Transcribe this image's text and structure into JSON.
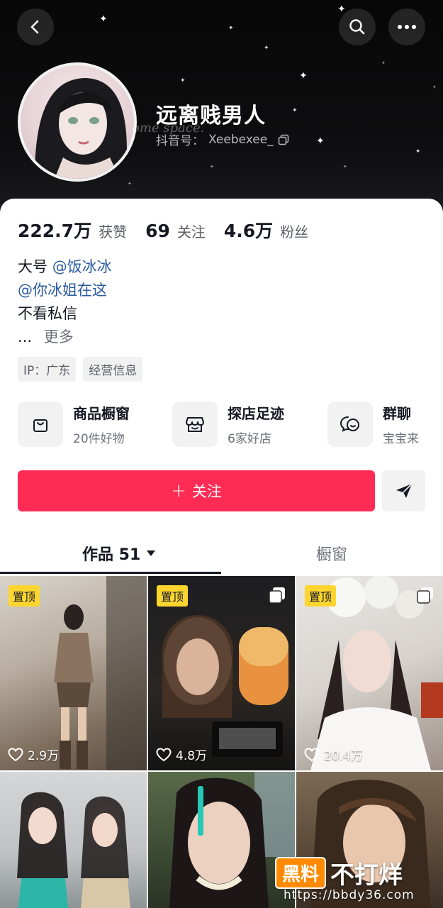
{
  "header": {
    "bg_text": "ome space.",
    "nickname": "远离贱男人",
    "douyin_id_label": "抖音号：",
    "douyin_id": "Xeebexee_"
  },
  "stats": [
    {
      "num": "222.7万",
      "label": "获赞"
    },
    {
      "num": "69",
      "label": "关注"
    },
    {
      "num": "4.6万",
      "label": "粉丝"
    }
  ],
  "bio": {
    "line1_prefix": "大号",
    "line1_mention": "@饭冰冰",
    "line2_mention": "@你冰姐在这",
    "line3": "不看私信",
    "ellipsis": "...",
    "more": "更多"
  },
  "tags": [
    "IP：广东",
    "经营信息"
  ],
  "services": [
    {
      "title": "商品橱窗",
      "sub": "20件好物",
      "icon": "shopping-bag-icon"
    },
    {
      "title": "探店足迹",
      "sub": "6家好店",
      "icon": "store-icon"
    },
    {
      "title": "群聊",
      "sub": "宝宝来",
      "icon": "chat-bubble-icon"
    }
  ],
  "actions": {
    "follow_label": "关注",
    "follow_plus": "+"
  },
  "tabs": {
    "works_label": "作品 51",
    "showcase_label": "橱窗"
  },
  "grid": [
    {
      "pinned": "置顶",
      "likes": "2.9万",
      "multi": false
    },
    {
      "pinned": "置顶",
      "likes": "4.8万",
      "multi": true
    },
    {
      "pinned": "置顶",
      "likes": "20.4万",
      "multi": true
    },
    {
      "pinned": "",
      "likes": "",
      "multi": false
    },
    {
      "pinned": "",
      "likes": "",
      "multi": false
    },
    {
      "pinned": "",
      "likes": "",
      "multi": false
    }
  ],
  "watermark": {
    "badge": "黑料",
    "text": "不打烊",
    "url": "https://bbdy36.com"
  },
  "colors": {
    "accent": "#fe2c55",
    "pin": "#fcd62e",
    "mention": "#2a5a9e"
  }
}
